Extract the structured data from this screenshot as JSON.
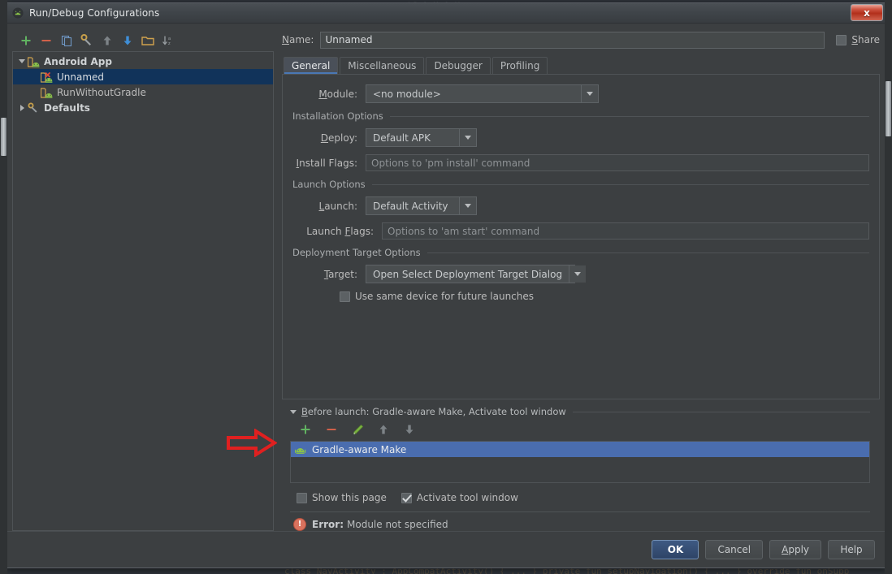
{
  "window": {
    "title": "Run/Debug Configurations",
    "title_icon": "android-studio-icon",
    "close_label": "x"
  },
  "left_toolbar": {
    "items": [
      {
        "name": "add-configuration-button",
        "icon": "plus-icon",
        "glyph": "+"
      },
      {
        "name": "remove-configuration-button",
        "icon": "minus-icon",
        "glyph": "−"
      },
      {
        "name": "copy-configuration-button",
        "icon": "copy-icon",
        "glyph": ""
      },
      {
        "name": "edit-defaults-button",
        "icon": "wrench-icon",
        "glyph": ""
      },
      {
        "name": "move-up-button",
        "icon": "arrow-up-icon",
        "glyph": ""
      },
      {
        "name": "move-down-button",
        "icon": "arrow-down-icon",
        "glyph": ""
      },
      {
        "name": "create-folder-button",
        "icon": "folder-icon",
        "glyph": ""
      },
      {
        "name": "sort-configurations-button",
        "icon": "sort-alpha-icon",
        "glyph": ""
      }
    ]
  },
  "tree": {
    "nodes": [
      {
        "label": "Android App",
        "icon": "android-folder-icon",
        "expanded": true,
        "level": 0,
        "selected": false,
        "bold": true
      },
      {
        "label": "Unnamed",
        "icon": "android-error-icon",
        "level": 1,
        "selected": true,
        "bold": false
      },
      {
        "label": "RunWithoutGradle",
        "icon": "android-icon",
        "level": 1,
        "selected": false,
        "bold": false
      },
      {
        "label": "Defaults",
        "icon": "wrench-icon",
        "expanded": false,
        "level": 0,
        "selected": false,
        "bold": true
      }
    ]
  },
  "name_field": {
    "label": "Name:",
    "label_mnemonic": "N",
    "value": "Unnamed"
  },
  "share": {
    "label": "Share",
    "label_mnemonic": "S",
    "checked": false
  },
  "tabs": [
    {
      "label": "General",
      "active": true
    },
    {
      "label": "Miscellaneous",
      "active": false
    },
    {
      "label": "Debugger",
      "active": false
    },
    {
      "label": "Profiling",
      "active": false
    }
  ],
  "general": {
    "module": {
      "label": "Module:",
      "label_mnemonic": "M",
      "value": "<no module>"
    },
    "installation_options": {
      "group_title": "Installation Options",
      "deploy": {
        "label": "Deploy:",
        "label_mnemonic": "D",
        "value": "Default APK"
      },
      "install_flags": {
        "label": "Install Flags:",
        "label_mnemonic": "I",
        "value": "",
        "placeholder": "Options to 'pm install' command"
      }
    },
    "launch_options": {
      "group_title": "Launch Options",
      "launch": {
        "label": "Launch:",
        "label_mnemonic": "L",
        "value": "Default Activity"
      },
      "launch_flags": {
        "label": "Launch Flags:",
        "label_mnemonic": "F",
        "value": "",
        "placeholder": "Options to 'am start' command"
      }
    },
    "deployment_target_options": {
      "group_title": "Deployment Target Options",
      "target": {
        "label": "Target:",
        "label_mnemonic": "T",
        "value": "Open Select Deployment Target Dialog"
      },
      "use_same_device": {
        "label": "Use same device for future launches",
        "checked": false
      }
    }
  },
  "before_launch": {
    "title": "Before launch: Gradle-aware Make, Activate tool window",
    "title_mnemonic": "B",
    "expanded": true,
    "toolbar": [
      {
        "name": "add-task-button",
        "icon": "plus-icon"
      },
      {
        "name": "remove-task-button",
        "icon": "minus-icon"
      },
      {
        "name": "edit-task-button",
        "icon": "pencil-icon"
      },
      {
        "name": "move-task-up-button",
        "icon": "arrow-up-icon"
      },
      {
        "name": "move-task-down-button",
        "icon": "arrow-down-icon"
      }
    ],
    "tasks": [
      {
        "label": "Gradle-aware Make",
        "icon": "android-icon",
        "selected": true
      }
    ],
    "show_this_page": {
      "label": "Show this page",
      "checked": false
    },
    "activate_tool_window": {
      "label": "Activate tool window",
      "checked": true
    }
  },
  "error": {
    "icon": "error-icon",
    "prefix": "Error:",
    "message": "Module not specified"
  },
  "footer_buttons": [
    {
      "label": "OK",
      "name": "ok-button",
      "default": true
    },
    {
      "label": "Cancel",
      "name": "cancel-button",
      "default": false
    },
    {
      "label": "Apply",
      "name": "apply-button",
      "default": false,
      "mnemonic": "A"
    },
    {
      "label": "Help",
      "name": "help-button",
      "default": false
    }
  ],
  "annotation": {
    "type": "red-arrow",
    "points_to": "Gradle-aware Make",
    "color": "#e02020"
  },
  "colors": {
    "window_bg": "#3c3f41",
    "selection_blue": "#4a6daf",
    "tree_selection": "#11335a",
    "accent_green": "#4aa74a",
    "accent_red": "#d9603f",
    "error_red": "#d9725e"
  }
}
